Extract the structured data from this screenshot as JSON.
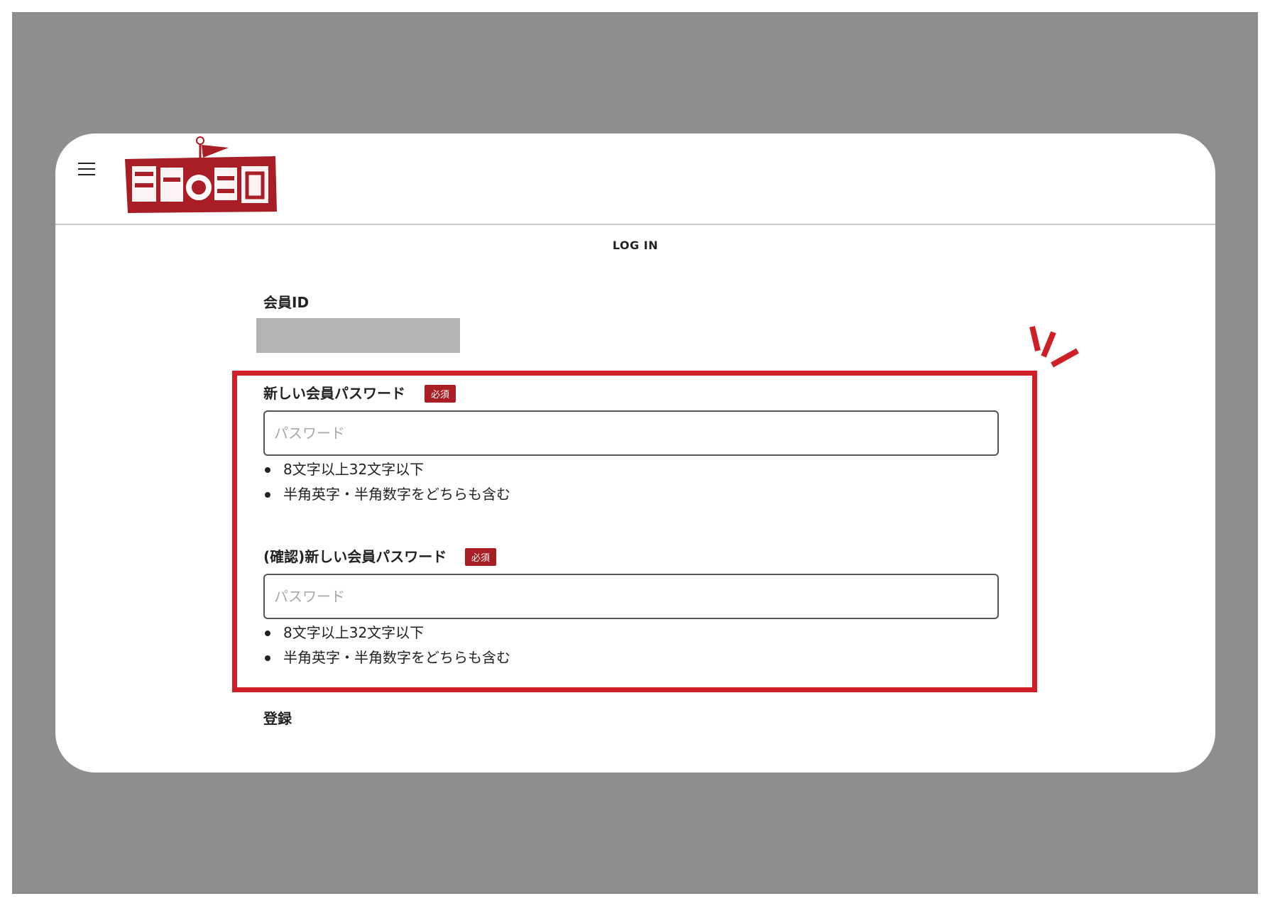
{
  "header": {
    "menu_icon": "hamburger-menu-icon",
    "logo_text": "餃子の王国"
  },
  "page_title": "LOG IN",
  "member_id": {
    "label": "会員ID",
    "value_state": "redacted"
  },
  "new_password": {
    "label": "新しい会員パスワード",
    "required_badge": "必須",
    "placeholder": "パスワード",
    "rules": [
      "8文字以上32文字以下",
      "半角英字・半角数字をどちらも含む"
    ]
  },
  "confirm_password": {
    "label": "(確認)新しい会員パスワード",
    "required_badge": "必須",
    "placeholder": "パスワード",
    "rules": [
      "8文字以上32文字以下",
      "半角英字・半角数字をどちらも含む"
    ]
  },
  "submit": {
    "label": "登録"
  },
  "colors": {
    "backdrop": "#8e8e8c",
    "brand_red": "#a81e24",
    "highlight_red": "#cf2027"
  }
}
